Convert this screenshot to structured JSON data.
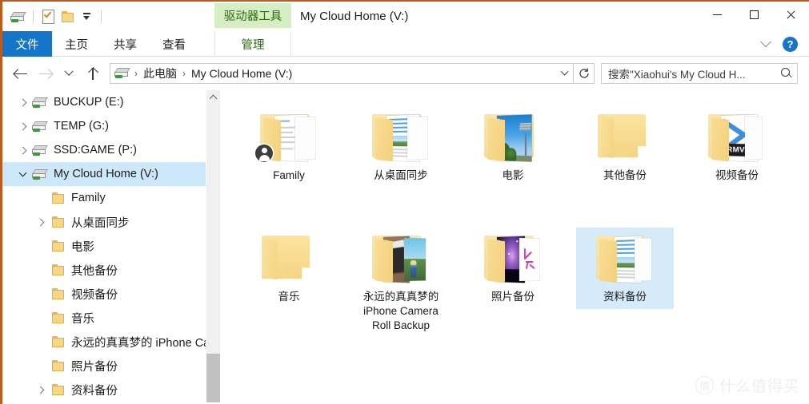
{
  "window": {
    "title": "My Cloud Home (V:)",
    "contextual_tab_group": "驱动器工具",
    "accent_color": "#1675c8",
    "contextual_tab_color": "#d6eec4",
    "selection_color": "#cde8fa"
  },
  "quick_access": {
    "items": [
      {
        "name": "drive-icon",
        "tooltip": "My Cloud Home (V:)"
      },
      {
        "name": "properties-icon",
        "tooltip": "属性"
      },
      {
        "name": "new-folder-icon",
        "tooltip": "新建文件夹"
      },
      {
        "name": "customize-caret-icon",
        "tooltip": "自定义快速访问工具栏"
      }
    ]
  },
  "window_controls": {
    "minimize": "最小化",
    "maximize": "最大化",
    "close": "关闭"
  },
  "ribbon": {
    "tabs": [
      {
        "label": "文件",
        "active": true,
        "style": "file"
      },
      {
        "label": "主页",
        "active": false,
        "style": "normal"
      },
      {
        "label": "共享",
        "active": false,
        "style": "normal"
      },
      {
        "label": "查看",
        "active": false,
        "style": "normal"
      }
    ],
    "contextual_tab": {
      "label": "管理"
    },
    "collapse_label": "折叠功能区",
    "help_label": "?"
  },
  "address_bar": {
    "back": "后退",
    "forward": "前进",
    "recent": "最近浏览的位置",
    "up": "上移到",
    "refresh": "刷新",
    "breadcrumb": [
      {
        "label": "此电脑"
      },
      {
        "label": "My Cloud Home (V:)"
      }
    ],
    "separator": "›"
  },
  "search": {
    "placeholder": "搜索\"Xiaohui's My Cloud H..."
  },
  "sidebar": {
    "items": [
      {
        "label": "BUCKUP (E:)",
        "icon": "drive-icon",
        "indent": 0,
        "expander": "collapsed",
        "selected": false
      },
      {
        "label": "TEMP (G:)",
        "icon": "drive-icon",
        "indent": 0,
        "expander": "collapsed",
        "selected": false
      },
      {
        "label": "SSD:GAME (P:)",
        "icon": "drive-icon",
        "indent": 0,
        "expander": "collapsed",
        "selected": false
      },
      {
        "label": "My Cloud Home (V:)",
        "icon": "drive-icon",
        "indent": 0,
        "expander": "expanded",
        "selected": true
      },
      {
        "label": "Family",
        "icon": "folder-icon",
        "indent": 1,
        "expander": "none",
        "selected": false
      },
      {
        "label": "从桌面同步",
        "icon": "folder-icon",
        "indent": 1,
        "expander": "collapsed",
        "selected": false
      },
      {
        "label": "电影",
        "icon": "folder-icon",
        "indent": 1,
        "expander": "none",
        "selected": false
      },
      {
        "label": "其他备份",
        "icon": "folder-icon",
        "indent": 1,
        "expander": "none",
        "selected": false
      },
      {
        "label": "视频备份",
        "icon": "folder-icon",
        "indent": 1,
        "expander": "none",
        "selected": false
      },
      {
        "label": "音乐",
        "icon": "folder-icon",
        "indent": 1,
        "expander": "none",
        "selected": false
      },
      {
        "label": "永远的真真梦的 iPhone Cam",
        "icon": "folder-icon",
        "indent": 1,
        "expander": "none",
        "selected": false
      },
      {
        "label": "照片备份",
        "icon": "folder-icon",
        "indent": 1,
        "expander": "none",
        "selected": false
      },
      {
        "label": "资料备份",
        "icon": "folder-icon",
        "indent": 1,
        "expander": "collapsed",
        "selected": false
      }
    ],
    "scrollbar": {
      "up_arrow": "向上滚动"
    }
  },
  "content": {
    "items": [
      {
        "label": "Family",
        "thumb": "document",
        "shared": true,
        "selected": false
      },
      {
        "label": "从桌面同步",
        "thumb": "notes",
        "shared": false,
        "selected": false
      },
      {
        "label": "电影",
        "thumb": "sky",
        "shared": false,
        "selected": false
      },
      {
        "label": "其他备份",
        "thumb": "empty",
        "shared": false,
        "selected": false
      },
      {
        "label": "视频备份",
        "thumb": "rmvb",
        "shared": false,
        "selected": false,
        "badge_text": "RMVB"
      },
      {
        "label": "音乐",
        "thumb": "empty",
        "shared": false,
        "selected": false
      },
      {
        "label": "永远的真真梦的 iPhone Camera Roll Backup",
        "thumb": "ipad",
        "shared": false,
        "selected": false
      },
      {
        "label": "照片备份",
        "thumb": "galaxy",
        "shared": false,
        "selected": false
      },
      {
        "label": "资料备份",
        "thumb": "notes",
        "shared": false,
        "selected": true
      }
    ]
  },
  "watermark": {
    "logo": "值",
    "text": "什么值得买"
  }
}
